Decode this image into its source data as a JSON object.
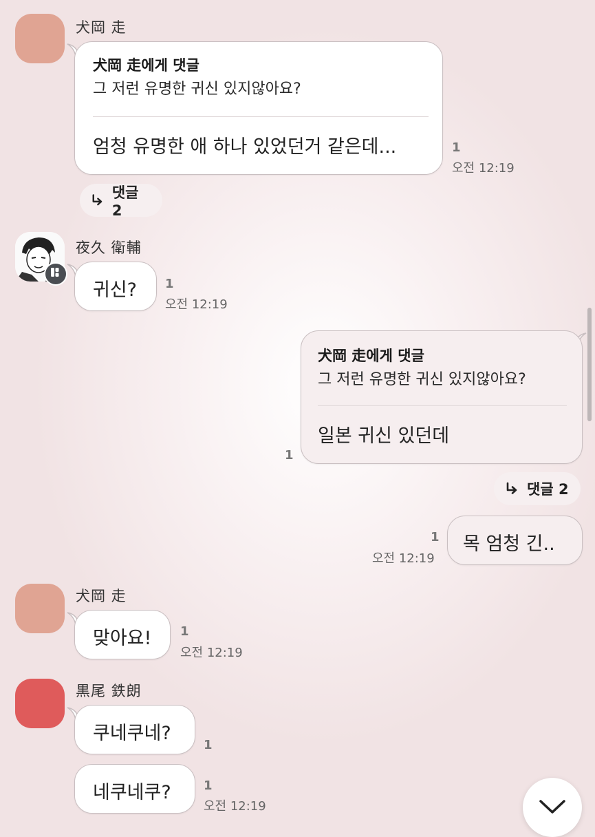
{
  "colors": {
    "avatar_inuoka": "#e0a493",
    "avatar_kuroo": "#df5b5b",
    "bubble_border": "#c9bfc1",
    "mine_bubble": "#f6eeef"
  },
  "messages": {
    "m1": {
      "sender": "犬岡 走",
      "reply_to": "犬岡 走에게 댓글",
      "quote": "그 저런 유명한 귀신 있지않아요?",
      "text": "엄청 유명한 애 하나 있었던거 같은데...",
      "count": "1",
      "time": "오전 12:19",
      "thread_label": "댓글 2"
    },
    "m2": {
      "sender": "夜久 衛輔",
      "text": "귀신?",
      "count": "1",
      "time": "오전 12:19"
    },
    "m3": {
      "reply_to": "犬岡 走에게 댓글",
      "quote": "그 저런 유명한 귀신 있지않아요?",
      "text": "일본 귀신 있던데",
      "count": "1",
      "thread_label": "댓글 2"
    },
    "m4": {
      "text": "목 엄청 긴..",
      "count": "1",
      "time": "오전 12:19"
    },
    "m5": {
      "sender": "犬岡 走",
      "text": "맞아요!",
      "count": "1",
      "time": "오전 12:19"
    },
    "m6": {
      "sender": "黒尾 鉄朗",
      "text": "쿠네쿠네?",
      "count": "1"
    },
    "m7": {
      "text": "네쿠네쿠?",
      "count": "1",
      "time": "오전 12:19"
    }
  },
  "icons": {
    "thread": "reply-arrow-icon",
    "scroll_down": "chevron-down-icon",
    "badge": "openchat-badge-icon"
  }
}
